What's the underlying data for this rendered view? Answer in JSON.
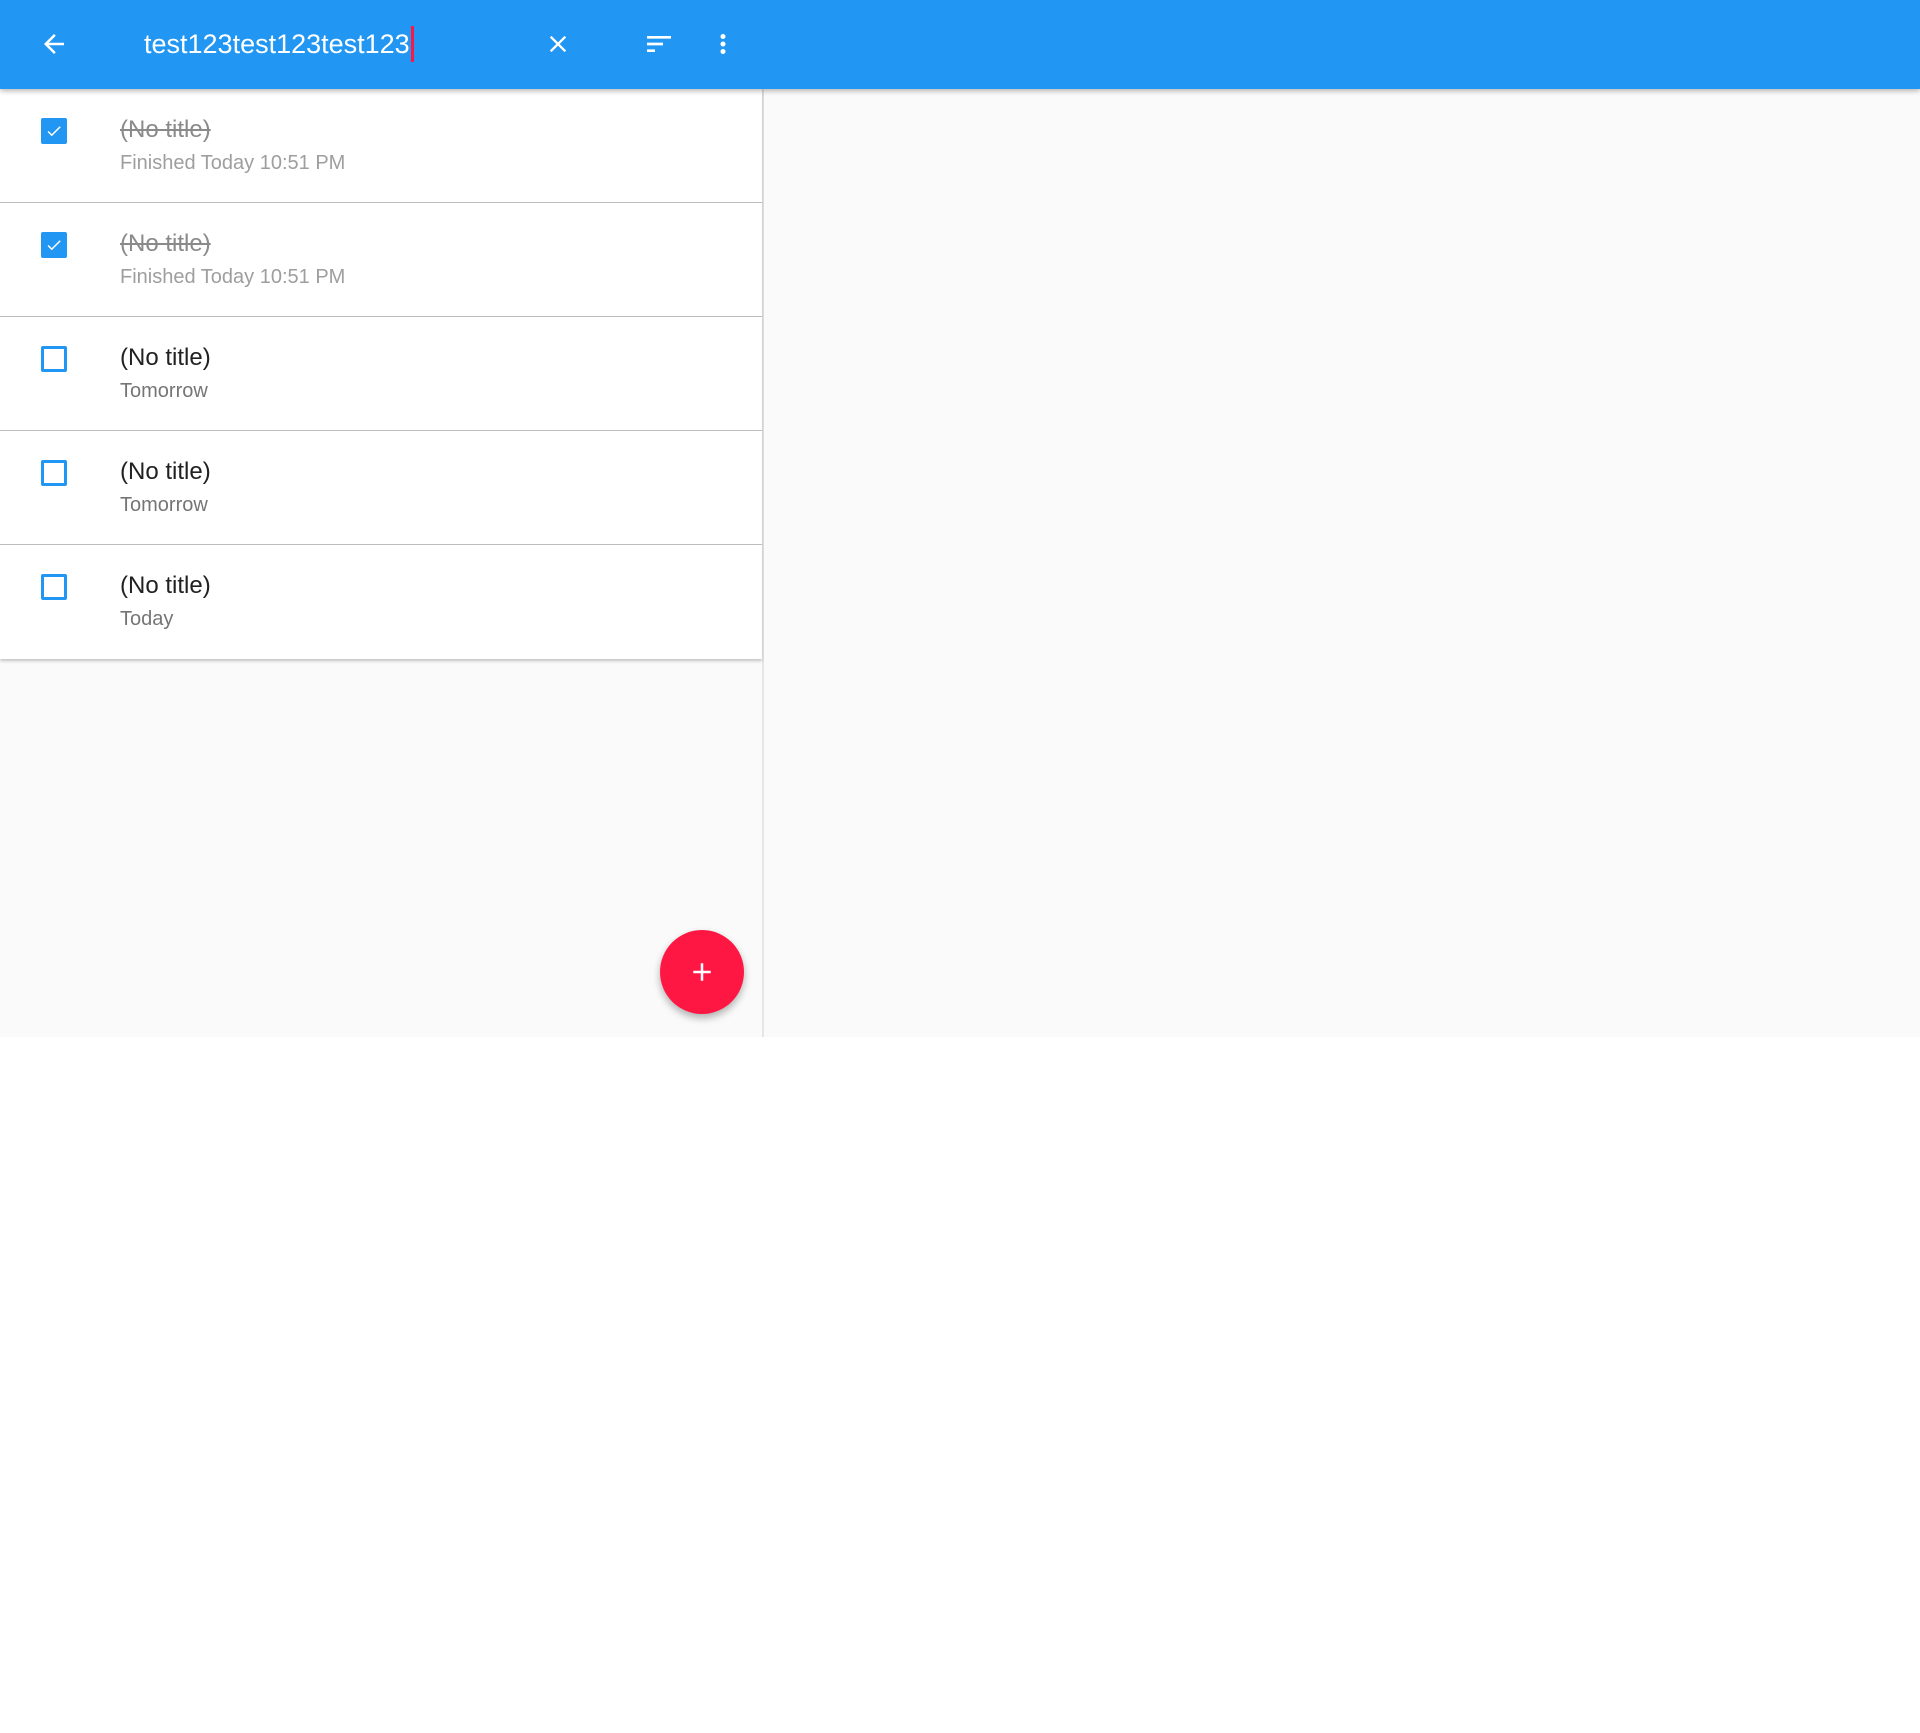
{
  "toolbar": {
    "background": "#2196f3",
    "back_icon": "arrow-back-icon",
    "search_value": "test123test123test123",
    "clear_icon": "close-icon",
    "sort_icon": "sort-icon",
    "more_icon": "more-vert-icon"
  },
  "tasks": [
    {
      "title": "(No title)",
      "subtitle": "Finished Today 10:51 PM",
      "checked": true
    },
    {
      "title": "(No title)",
      "subtitle": "Finished Today 10:51 PM",
      "checked": true
    },
    {
      "title": "(No title)",
      "subtitle": "Tomorrow",
      "checked": false
    },
    {
      "title": "(No title)",
      "subtitle": "Tomorrow",
      "checked": false
    },
    {
      "title": "(No title)",
      "subtitle": "Today",
      "checked": false
    }
  ],
  "fab": {
    "icon": "add-icon",
    "color": "#ff1744"
  },
  "colors": {
    "accent": "#ff1744",
    "primary": "#2196f3"
  }
}
